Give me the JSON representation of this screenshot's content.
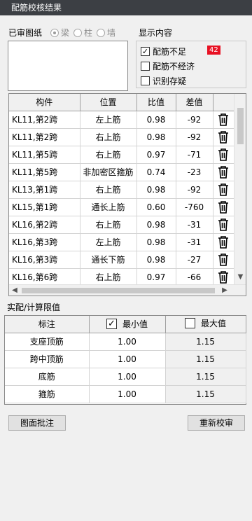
{
  "window": {
    "title": "配筋校核结果"
  },
  "drawing": {
    "label": "已审图纸",
    "options": [
      {
        "label": "梁",
        "selected": true
      },
      {
        "label": "柱",
        "selected": false
      },
      {
        "label": "墙",
        "selected": false
      }
    ]
  },
  "display": {
    "label": "显示内容",
    "options": [
      {
        "label": "配筋不足",
        "checked": true,
        "badge": "42"
      },
      {
        "label": "配筋不经济",
        "checked": false
      },
      {
        "label": "识别存疑",
        "checked": false
      }
    ]
  },
  "results": {
    "columns": [
      "构件",
      "位置",
      "比值",
      "差值",
      ""
    ],
    "rows": [
      {
        "member": "KL11,第2跨",
        "position": "左上筋",
        "ratio": "0.98",
        "diff": "-92"
      },
      {
        "member": "KL11,第2跨",
        "position": "右上筋",
        "ratio": "0.98",
        "diff": "-92"
      },
      {
        "member": "KL11,第5跨",
        "position": "右上筋",
        "ratio": "0.97",
        "diff": "-71"
      },
      {
        "member": "KL11,第5跨",
        "position": "非加密区箍筋",
        "ratio": "0.74",
        "diff": "-23"
      },
      {
        "member": "KL13,第1跨",
        "position": "右上筋",
        "ratio": "0.98",
        "diff": "-92"
      },
      {
        "member": "KL15,第1跨",
        "position": "通长上筋",
        "ratio": "0.60",
        "diff": "-760"
      },
      {
        "member": "KL16,第2跨",
        "position": "右上筋",
        "ratio": "0.98",
        "diff": "-31"
      },
      {
        "member": "KL16,第3跨",
        "position": "左上筋",
        "ratio": "0.98",
        "diff": "-31"
      },
      {
        "member": "KL16,第3跨",
        "position": "通长下筋",
        "ratio": "0.98",
        "diff": "-27"
      },
      {
        "member": "KL16,第6跨",
        "position": "右上筋",
        "ratio": "0.97",
        "diff": "-66"
      }
    ],
    "row_icon": "trash-icon"
  },
  "limits": {
    "section_label": "实配/计算限值",
    "columns": {
      "label": "标注",
      "min": "最小值",
      "min_checked": true,
      "max": "最大值",
      "max_checked": false
    },
    "rows": [
      {
        "label": "支座顶筋",
        "min": "1.00",
        "max": "1.15"
      },
      {
        "label": "跨中顶筋",
        "min": "1.00",
        "max": "1.15"
      },
      {
        "label": "底筋",
        "min": "1.00",
        "max": "1.15"
      },
      {
        "label": "箍筋",
        "min": "1.00",
        "max": "1.15"
      }
    ]
  },
  "buttons": {
    "annotate": "图面批注",
    "recheck": "重新校审"
  }
}
